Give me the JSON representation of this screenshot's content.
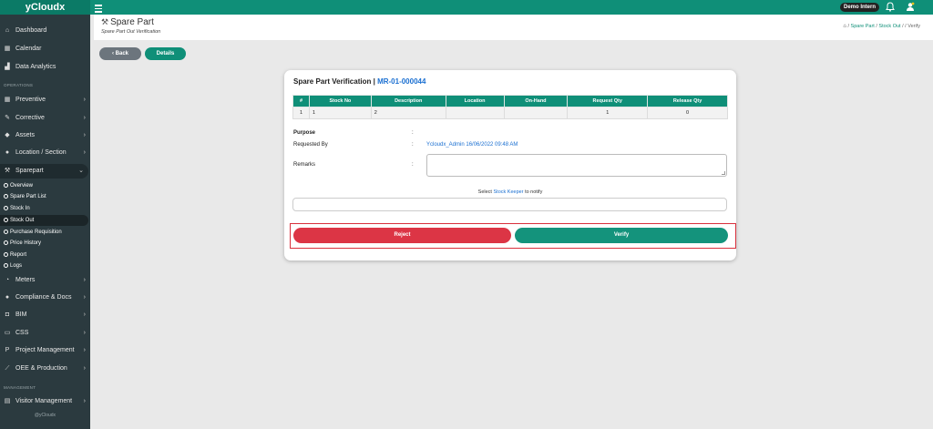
{
  "app": {
    "brand": "yCloudx",
    "user_badge": "Demo Intern"
  },
  "sidebar": {
    "items": [
      {
        "label": "Dashboard",
        "icon": "home-icon"
      },
      {
        "label": "Calendar",
        "icon": "calendar-icon"
      },
      {
        "label": "Data Analytics",
        "icon": "chart-icon"
      },
      {
        "label": "Preventive",
        "icon": "calendar-icon"
      },
      {
        "label": "Corrective",
        "icon": "wrench-icon"
      },
      {
        "label": "Assets",
        "icon": "tag-icon"
      },
      {
        "label": "Location / Section",
        "icon": "map-pin-icon"
      },
      {
        "label": "Sparepart",
        "icon": "tools-icon"
      },
      {
        "label": "Meters",
        "icon": "gauge-icon"
      },
      {
        "label": "Compliance & Docs",
        "icon": "circle-icon"
      },
      {
        "label": "BIM",
        "icon": "cube-icon"
      },
      {
        "label": "CSS",
        "icon": "monitor-icon"
      },
      {
        "label": "Project Management",
        "icon": "project-icon"
      },
      {
        "label": "OEE & Production",
        "icon": "line-chart-icon"
      },
      {
        "label": "Visitor Management",
        "icon": "id-card-icon"
      }
    ],
    "sections": {
      "operations": "OPERATIONS",
      "management": "MANAGEMENT"
    },
    "subitems": [
      "Overview",
      "Spare Part List",
      "Stock In",
      "Stock Out",
      "Purchase Requisition",
      "Price History",
      "Report",
      "Logs"
    ],
    "footer": "@yCloudx"
  },
  "header": {
    "title": "Spare Part",
    "subtitle": "Spare Part Out Verification",
    "breadcrumb": [
      "Spare Part",
      "Stock Out",
      "Verify"
    ]
  },
  "toolbar": {
    "back_label": "Back",
    "details_label": "Details"
  },
  "card": {
    "title_prefix": "Spare Part Verification |",
    "ref": "MR-01-000044",
    "table": {
      "headers": [
        "#",
        "Stock No",
        "Description",
        "Location",
        "On-Hand",
        "Request Qty",
        "Release Qty"
      ],
      "rows": [
        [
          "1",
          "1",
          "2",
          "",
          "",
          "1",
          "0"
        ]
      ]
    },
    "fields": {
      "purpose_label": "Purpose",
      "requested_by_label": "Requested By",
      "requested_by_value": "Ycloudx_Admin 16/06/2022 09:48 AM",
      "remarks_label": "Remarks",
      "colon": ":"
    },
    "notify": {
      "prefix": "Select",
      "keeper": "Stock Keeper",
      "suffix": "to notify"
    },
    "actions": {
      "reject_label": "Reject",
      "verify_label": "Verify"
    }
  },
  "colors": {
    "primary": "#0f8f78",
    "danger": "#dc3545",
    "sidebar": "#2b3a3f",
    "link": "#1a6fd1"
  }
}
